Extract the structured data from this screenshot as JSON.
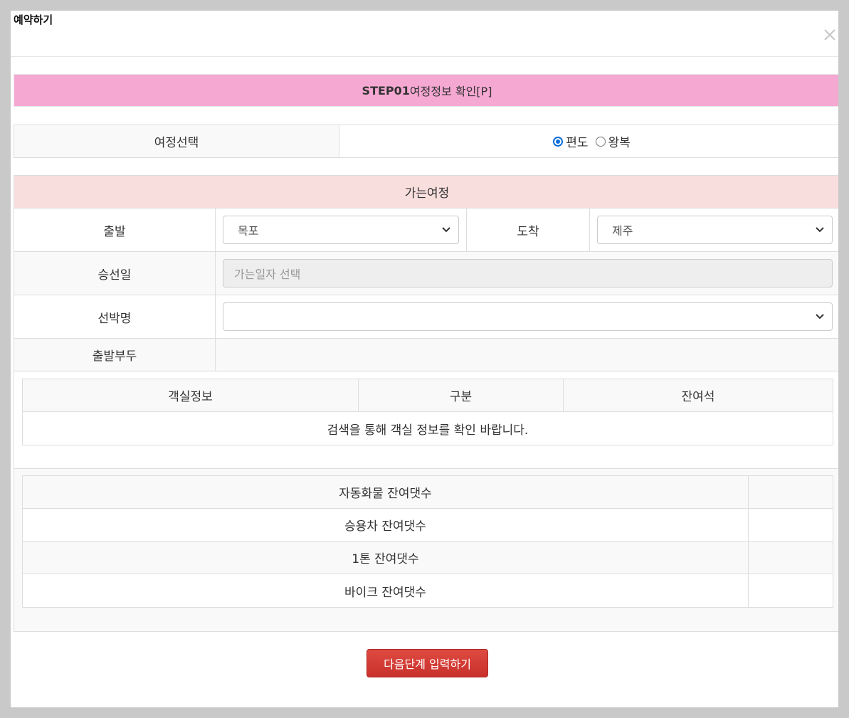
{
  "modal": {
    "title": "예약하기"
  },
  "step": {
    "code": "STEP01",
    "title": "여정정보 확인[P]"
  },
  "trip_type": {
    "label": "여정선택",
    "options": [
      "편도",
      "왕복"
    ],
    "selected": "편도"
  },
  "journey": {
    "header": "가는여정",
    "departure_label": "출발",
    "departure_value": "목포",
    "arrival_label": "도착",
    "arrival_value": "제주",
    "date_label": "승선일",
    "date_placeholder": "가는일자 선택",
    "ship_label": "선박명",
    "ship_value": "",
    "pier_label": "출발부두",
    "pier_value": ""
  },
  "cabin_table": {
    "headers": [
      "객실정보",
      "구분",
      "잔여석"
    ],
    "empty_message": "검색을 통해 객실 정보를 확인 바랍니다."
  },
  "vehicle_table": {
    "rows": [
      {
        "label": "자동화물 잔여댓수",
        "value": ""
      },
      {
        "label": "승용차 잔여댓수",
        "value": ""
      },
      {
        "label": "1톤 잔여댓수",
        "value": ""
      },
      {
        "label": "바이크 잔여댓수",
        "value": ""
      }
    ]
  },
  "actions": {
    "next_label": "다음단계 입력하기"
  },
  "colors": {
    "step_bar": "#f5a8d2",
    "journey_header": "#f9dede",
    "next_button": "#d9534f",
    "radio_checked": "#0a6dd8"
  }
}
